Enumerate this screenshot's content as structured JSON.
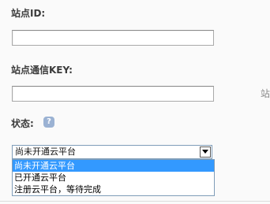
{
  "site_id": {
    "label": "站点ID:",
    "value": ""
  },
  "site_key": {
    "label": "站点通信KEY:",
    "value": "",
    "side_hint": "站"
  },
  "status": {
    "label": "状态:",
    "help_icon_glyph": "?",
    "selected": "尚未开通云平台",
    "options": [
      "尚未开通云平台",
      "已开通云平台",
      "注册云平台，等待完成"
    ],
    "highlighted_index": 0
  },
  "colors": {
    "highlight": "#3399ff",
    "help_icon": "#9bb2d3",
    "label_text": "#3a3a3a"
  }
}
